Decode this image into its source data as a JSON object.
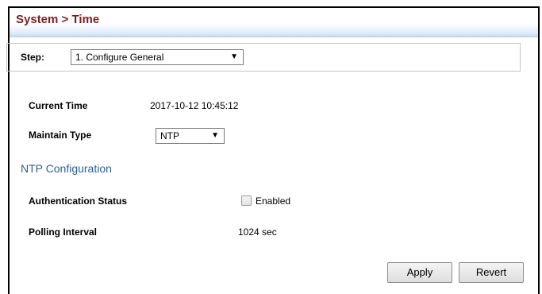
{
  "page": {
    "title": "System > Time"
  },
  "step": {
    "label": "Step:",
    "selected": "1. Configure General"
  },
  "general": {
    "current_time_label": "Current Time",
    "current_time_value": "2017-10-12 10:45:12",
    "maintain_type_label": "Maintain Type",
    "maintain_type_value": "NTP"
  },
  "ntp": {
    "section_title": "NTP Configuration",
    "auth_status_label": "Authentication Status",
    "auth_enabled_label": "Enabled",
    "auth_enabled_checked": false,
    "polling_interval_label": "Polling Interval",
    "polling_interval_value": "1024 sec"
  },
  "actions": {
    "apply_label": "Apply",
    "revert_label": "Revert"
  },
  "icons": {
    "dropdown": "triangle-down-icon",
    "checkbox": "checkbox-icon"
  },
  "colors": {
    "title": "#7a1f23",
    "section": "#2d5f9b",
    "header_fade": "#c9dcf4"
  }
}
